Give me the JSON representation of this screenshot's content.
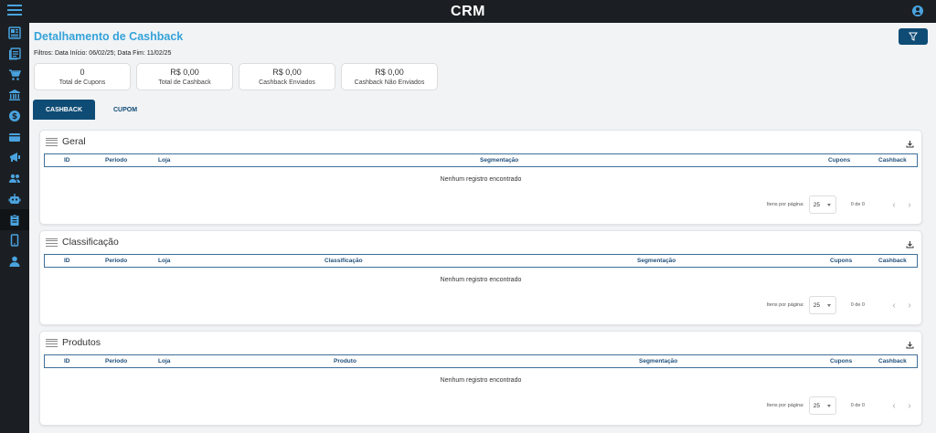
{
  "app": {
    "title": "CRM"
  },
  "sidebar": {
    "items": [
      {
        "icon": "dashboard-icon"
      },
      {
        "icon": "report-icon"
      },
      {
        "icon": "cart-icon"
      },
      {
        "icon": "bank-icon"
      },
      {
        "icon": "dollar-icon"
      },
      {
        "icon": "wallet-icon"
      },
      {
        "icon": "megaphone-icon"
      },
      {
        "icon": "people-icon"
      },
      {
        "icon": "robot-icon"
      },
      {
        "icon": "clipboard-icon",
        "active": true
      },
      {
        "icon": "phone-icon"
      },
      {
        "icon": "person-icon"
      }
    ]
  },
  "page": {
    "title": "Detalhamento de Cashback",
    "filters": "Filtros: Data Início: 06/02/25; Data Fim: 11/02/25"
  },
  "summary": [
    {
      "value": "0",
      "label": "Total de Cupons"
    },
    {
      "value": "R$ 0,00",
      "label": "Total de Cashback"
    },
    {
      "value": "R$ 0,00",
      "label": "Cashback Enviados"
    },
    {
      "value": "R$ 0,00",
      "label": "Cashback Não Enviados"
    }
  ],
  "tabs": [
    {
      "label": "CASHBACK",
      "active": true
    },
    {
      "label": "CUPOM",
      "active": false
    }
  ],
  "panels": [
    {
      "title": "Geral",
      "columns": [
        "ID",
        "Periodo",
        "Loja",
        "Segmentação",
        "Cupons",
        "Cashback"
      ],
      "empty": "Nenhum registro encontrado",
      "items_per_page_label": "Itens por página:",
      "items_per_page": "25",
      "range": "0 de 0"
    },
    {
      "title": "Classificação",
      "columns": [
        "ID",
        "Periodo",
        "Loja",
        "Classificação",
        "Segmentação",
        "Cupons",
        "Cashback"
      ],
      "empty": "Nenhum registro encontrado",
      "items_per_page_label": "Itens por página:",
      "items_per_page": "25",
      "range": "0 de 0"
    },
    {
      "title": "Produtos",
      "columns": [
        "ID",
        "Periodo",
        "Loja",
        "Produto",
        "Segmentação",
        "Cupons",
        "Cashback"
      ],
      "empty": "Nenhum registro encontrado",
      "items_per_page_label": "Itens por página:",
      "items_per_page": "25",
      "range": "0 de 0"
    }
  ],
  "colors": {
    "accent": "#35a3d9",
    "primary": "#0f4c75",
    "sidebar": "#1b1f23"
  }
}
